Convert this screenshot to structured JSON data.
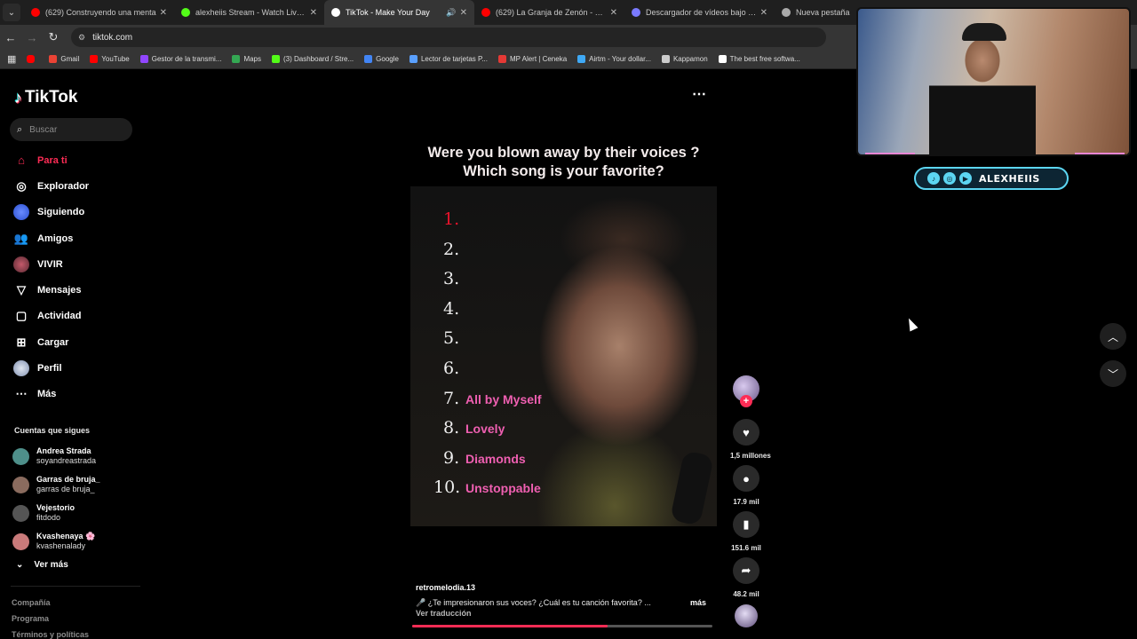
{
  "browser": {
    "tabs": [
      {
        "title": "(629) Construyendo una menta",
        "favicon_color": "#ff0000",
        "icon": "youtube-icon"
      },
      {
        "title": "alexheiis Stream - Watch Live o",
        "favicon_color": "#53fc18",
        "icon": "kick-icon"
      },
      {
        "title": "TikTok - Make Your Day",
        "favicon_color": "#ffffff",
        "icon": "tiktok-icon",
        "active": true
      },
      {
        "title": "(629) La Granja de Zenón - Las",
        "favicon_color": "#ff0000",
        "icon": "youtube-icon"
      },
      {
        "title": "Descargador de vídeos bajo de",
        "favicon_color": "#7a7aff",
        "icon": "download-icon"
      },
      {
        "title": "Nueva pestaña",
        "favicon_color": "#aaaaaa",
        "icon": "globe-icon"
      }
    ],
    "url": "tiktok.com",
    "bookmarks": [
      {
        "label": "Gmail",
        "color": "#ea4335"
      },
      {
        "label": "YouTube",
        "color": "#ff0000"
      },
      {
        "label": "Gestor de la transmi...",
        "color": "#9146ff"
      },
      {
        "label": "Maps",
        "color": "#34a853"
      },
      {
        "label": "(3) Dashboard / Stre...",
        "color": "#53fc18"
      },
      {
        "label": "Google",
        "color": "#4285f4"
      },
      {
        "label": "Lector de tarjetas P...",
        "color": "#5aa0ff"
      },
      {
        "label": "MP Alert | Ceneka",
        "color": "#e53935"
      },
      {
        "label": "Airtm - Your dollar...",
        "color": "#3fa9f5"
      },
      {
        "label": "Kappamon",
        "color": "#cccccc"
      },
      {
        "label": "The best free softwa...",
        "color": "#ffffff"
      }
    ]
  },
  "tiktok": {
    "brand": "TikTok",
    "search_placeholder": "Buscar",
    "nav": [
      {
        "label": "Para ti",
        "icon": "home-icon",
        "active": true
      },
      {
        "label": "Explorador",
        "icon": "compass-icon"
      },
      {
        "label": "Siguiendo",
        "icon": "following-icon"
      },
      {
        "label": "Amigos",
        "icon": "friends-icon"
      },
      {
        "label": "VIVIR",
        "icon": "live-icon"
      },
      {
        "label": "Mensajes",
        "icon": "messages-icon"
      },
      {
        "label": "Actividad",
        "icon": "activity-icon"
      },
      {
        "label": "Cargar",
        "icon": "upload-icon"
      },
      {
        "label": "Perfil",
        "icon": "profile-icon"
      },
      {
        "label": "Más",
        "icon": "more-icon"
      }
    ],
    "following_title": "Cuentas que sigues",
    "following": [
      {
        "name": "Andrea Strada",
        "handle": "soyandreastrada",
        "color": "#4e8f8a"
      },
      {
        "name": "Garras de bruja_",
        "handle": "garras de bruja_",
        "color": "#8a6b5e"
      },
      {
        "name": "Vejestorio",
        "handle": "fitdodo",
        "color": "#555555"
      },
      {
        "name": "Kvashenaya 🌸",
        "handle": "kvashenalady",
        "color": "#c97a7a"
      }
    ],
    "see_more": "Ver más",
    "footer": [
      "Compañía",
      "Programa",
      "Términos y políticas"
    ],
    "video": {
      "question_line1": "Were you blown away by their voices ?",
      "question_line2": "Which song is your favorite?",
      "ranks": [
        "1.",
        "2.",
        "3.",
        "4.",
        "5.",
        "6.",
        "7.",
        "8.",
        "9.",
        "10."
      ],
      "songs": [
        "",
        "",
        "",
        "",
        "",
        "",
        "All by Myself",
        "Lovely",
        "Diamonds",
        "Unstoppable"
      ],
      "author": "retromelodia.13",
      "caption": "🎤 ¿Te impresionaron sus voces? ¿Cuál es tu canción favorita? ...",
      "caption_more": "más",
      "translate": "Ver traducción",
      "progress": 0.65
    },
    "actions": {
      "likes": "1,5 millones",
      "comments": "17.9 mil",
      "saves": "151.6 mil",
      "shares": "48.2 mil"
    }
  },
  "overlay": {
    "social_name": "ALEXHEIIS",
    "social_icons": [
      "tiktok-icon",
      "instagram-icon",
      "youtube-icon"
    ]
  }
}
